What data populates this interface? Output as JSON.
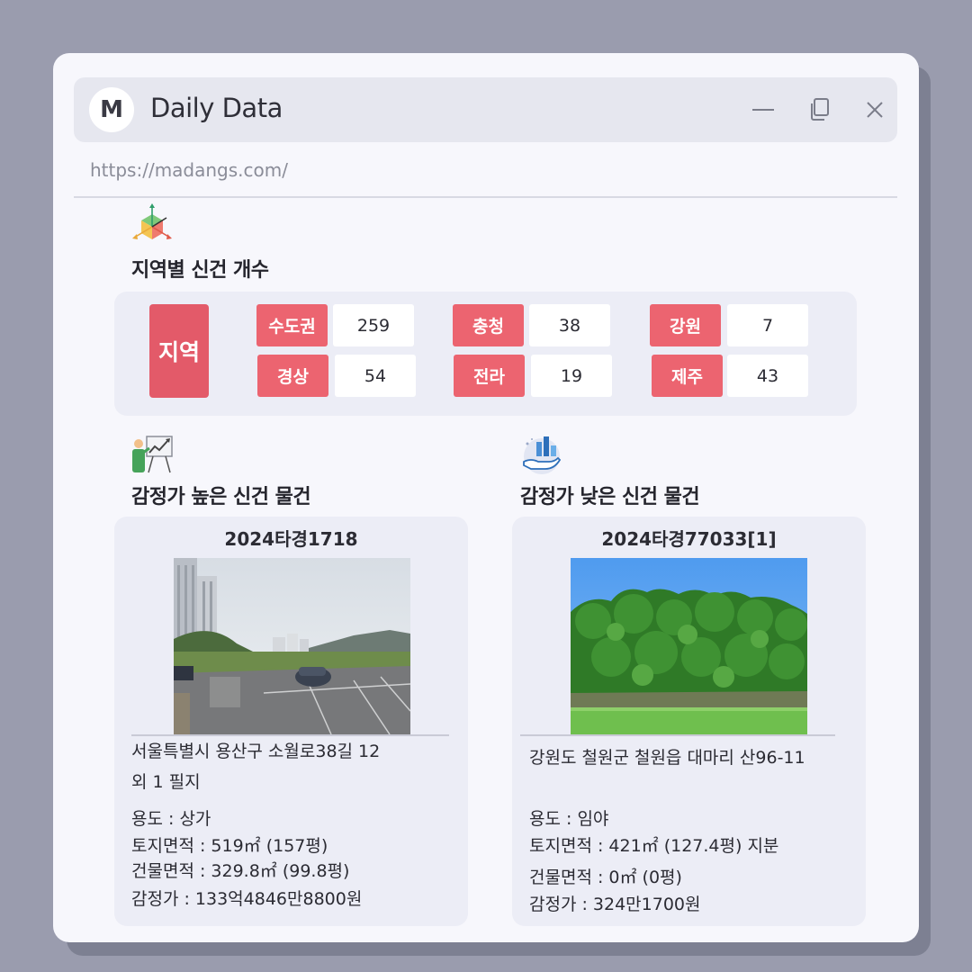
{
  "window": {
    "logo_letter": "M",
    "title": "Daily Data",
    "url": "https://madangs.com/"
  },
  "regions": {
    "title": "지역별 신건 개수",
    "header_label": "지역",
    "items": [
      {
        "name": "수도권",
        "count": "259"
      },
      {
        "name": "충청",
        "count": "38"
      },
      {
        "name": "강원",
        "count": "7"
      },
      {
        "name": "경상",
        "count": "54"
      },
      {
        "name": "전라",
        "count": "19"
      },
      {
        "name": "제주",
        "count": "43"
      }
    ]
  },
  "high": {
    "title": "감정가 높은 신건 물건",
    "case_no": "2024타경1718",
    "address_line1": "서울특별시 용산구 소월로38길 12",
    "address_line2": "외 1 필지",
    "usage": "용도 : 상가",
    "land_area": "토지면적 : 519㎡ (157평)",
    "building_area": "건물면적 : 329.8㎡ (99.8평)",
    "appraisal": "감정가 : 133억4846만8800원"
  },
  "low": {
    "title": "감정가 낮은 신건 물건",
    "case_no": "2024타경77033[1]",
    "address_line1": "강원도 철원군 철원읍 대마리 산96-11",
    "usage": "용도 : 임야",
    "land_area": "토지면적 : 421㎡ (127.4평) 지분",
    "building_area": "건물면적 : 0㎡ (0평)",
    "appraisal": "감정가 : 324만1700원"
  },
  "icons": {
    "minimize": "minimize-icon",
    "restore": "restore-icon",
    "close": "close-icon",
    "region": "cube-axes-icon",
    "high": "presentation-chart-icon",
    "low": "hand-chart-icon"
  },
  "colors": {
    "accent": "#ec6470",
    "accent_dark": "#e35a69",
    "panel": "#ecedf6",
    "background": "#9a9cae"
  }
}
